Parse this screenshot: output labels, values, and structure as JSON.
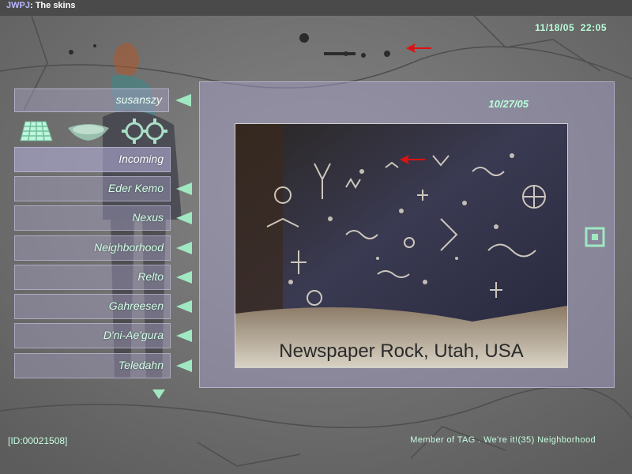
{
  "window": {
    "user": "JWPJ",
    "separator": ": ",
    "title": "The skins"
  },
  "clock": {
    "date": "11/18/05",
    "time": "22:05"
  },
  "player": {
    "name": "susanszy"
  },
  "content": {
    "date": "10/27/05",
    "caption": "Newspaper Rock, Utah, USA"
  },
  "age_list": {
    "items": [
      {
        "label": "Incoming"
      },
      {
        "label": "Eder Kemo"
      },
      {
        "label": "Nexus"
      },
      {
        "label": "Neighborhood"
      },
      {
        "label": "Relto"
      },
      {
        "label": "Gahreesen"
      },
      {
        "label": "D'ni-Ae'gura"
      },
      {
        "label": "Teledahn"
      }
    ]
  },
  "status": {
    "id": "[ID:00021508]",
    "membership": "Member of TAG . We're it!(35) Neighborhood"
  },
  "icons": {
    "toolbar": [
      "grid-tiles-icon",
      "fountain-icon",
      "gears-icon"
    ],
    "link_arrow": "triangle-left-icon",
    "scroll": "triangle-down-icon",
    "settings": "square-dot-icon"
  },
  "colors": {
    "accent": "#b9ffd9",
    "arrow": "#9fe8c2",
    "panel": "#aaa5c8",
    "marker": "#e01010"
  }
}
